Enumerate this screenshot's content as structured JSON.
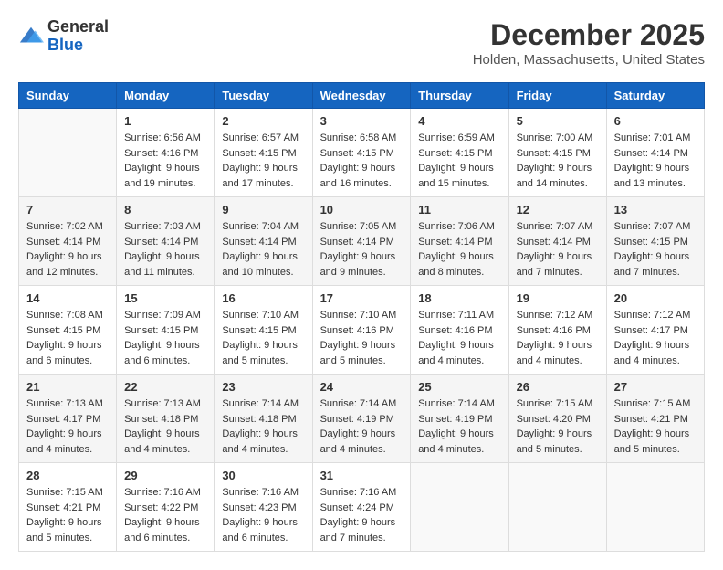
{
  "logo": {
    "general": "General",
    "blue": "Blue"
  },
  "title": {
    "month": "December 2025",
    "location": "Holden, Massachusetts, United States"
  },
  "headers": [
    "Sunday",
    "Monday",
    "Tuesday",
    "Wednesday",
    "Thursday",
    "Friday",
    "Saturday"
  ],
  "weeks": [
    [
      {
        "day": "",
        "sunrise": "",
        "sunset": "",
        "daylight": ""
      },
      {
        "day": "1",
        "sunrise": "Sunrise: 6:56 AM",
        "sunset": "Sunset: 4:16 PM",
        "daylight": "Daylight: 9 hours and 19 minutes."
      },
      {
        "day": "2",
        "sunrise": "Sunrise: 6:57 AM",
        "sunset": "Sunset: 4:15 PM",
        "daylight": "Daylight: 9 hours and 17 minutes."
      },
      {
        "day": "3",
        "sunrise": "Sunrise: 6:58 AM",
        "sunset": "Sunset: 4:15 PM",
        "daylight": "Daylight: 9 hours and 16 minutes."
      },
      {
        "day": "4",
        "sunrise": "Sunrise: 6:59 AM",
        "sunset": "Sunset: 4:15 PM",
        "daylight": "Daylight: 9 hours and 15 minutes."
      },
      {
        "day": "5",
        "sunrise": "Sunrise: 7:00 AM",
        "sunset": "Sunset: 4:15 PM",
        "daylight": "Daylight: 9 hours and 14 minutes."
      },
      {
        "day": "6",
        "sunrise": "Sunrise: 7:01 AM",
        "sunset": "Sunset: 4:14 PM",
        "daylight": "Daylight: 9 hours and 13 minutes."
      }
    ],
    [
      {
        "day": "7",
        "sunrise": "Sunrise: 7:02 AM",
        "sunset": "Sunset: 4:14 PM",
        "daylight": "Daylight: 9 hours and 12 minutes."
      },
      {
        "day": "8",
        "sunrise": "Sunrise: 7:03 AM",
        "sunset": "Sunset: 4:14 PM",
        "daylight": "Daylight: 9 hours and 11 minutes."
      },
      {
        "day": "9",
        "sunrise": "Sunrise: 7:04 AM",
        "sunset": "Sunset: 4:14 PM",
        "daylight": "Daylight: 9 hours and 10 minutes."
      },
      {
        "day": "10",
        "sunrise": "Sunrise: 7:05 AM",
        "sunset": "Sunset: 4:14 PM",
        "daylight": "Daylight: 9 hours and 9 minutes."
      },
      {
        "day": "11",
        "sunrise": "Sunrise: 7:06 AM",
        "sunset": "Sunset: 4:14 PM",
        "daylight": "Daylight: 9 hours and 8 minutes."
      },
      {
        "day": "12",
        "sunrise": "Sunrise: 7:07 AM",
        "sunset": "Sunset: 4:14 PM",
        "daylight": "Daylight: 9 hours and 7 minutes."
      },
      {
        "day": "13",
        "sunrise": "Sunrise: 7:07 AM",
        "sunset": "Sunset: 4:15 PM",
        "daylight": "Daylight: 9 hours and 7 minutes."
      }
    ],
    [
      {
        "day": "14",
        "sunrise": "Sunrise: 7:08 AM",
        "sunset": "Sunset: 4:15 PM",
        "daylight": "Daylight: 9 hours and 6 minutes."
      },
      {
        "day": "15",
        "sunrise": "Sunrise: 7:09 AM",
        "sunset": "Sunset: 4:15 PM",
        "daylight": "Daylight: 9 hours and 6 minutes."
      },
      {
        "day": "16",
        "sunrise": "Sunrise: 7:10 AM",
        "sunset": "Sunset: 4:15 PM",
        "daylight": "Daylight: 9 hours and 5 minutes."
      },
      {
        "day": "17",
        "sunrise": "Sunrise: 7:10 AM",
        "sunset": "Sunset: 4:16 PM",
        "daylight": "Daylight: 9 hours and 5 minutes."
      },
      {
        "day": "18",
        "sunrise": "Sunrise: 7:11 AM",
        "sunset": "Sunset: 4:16 PM",
        "daylight": "Daylight: 9 hours and 4 minutes."
      },
      {
        "day": "19",
        "sunrise": "Sunrise: 7:12 AM",
        "sunset": "Sunset: 4:16 PM",
        "daylight": "Daylight: 9 hours and 4 minutes."
      },
      {
        "day": "20",
        "sunrise": "Sunrise: 7:12 AM",
        "sunset": "Sunset: 4:17 PM",
        "daylight": "Daylight: 9 hours and 4 minutes."
      }
    ],
    [
      {
        "day": "21",
        "sunrise": "Sunrise: 7:13 AM",
        "sunset": "Sunset: 4:17 PM",
        "daylight": "Daylight: 9 hours and 4 minutes."
      },
      {
        "day": "22",
        "sunrise": "Sunrise: 7:13 AM",
        "sunset": "Sunset: 4:18 PM",
        "daylight": "Daylight: 9 hours and 4 minutes."
      },
      {
        "day": "23",
        "sunrise": "Sunrise: 7:14 AM",
        "sunset": "Sunset: 4:18 PM",
        "daylight": "Daylight: 9 hours and 4 minutes."
      },
      {
        "day": "24",
        "sunrise": "Sunrise: 7:14 AM",
        "sunset": "Sunset: 4:19 PM",
        "daylight": "Daylight: 9 hours and 4 minutes."
      },
      {
        "day": "25",
        "sunrise": "Sunrise: 7:14 AM",
        "sunset": "Sunset: 4:19 PM",
        "daylight": "Daylight: 9 hours and 4 minutes."
      },
      {
        "day": "26",
        "sunrise": "Sunrise: 7:15 AM",
        "sunset": "Sunset: 4:20 PM",
        "daylight": "Daylight: 9 hours and 5 minutes."
      },
      {
        "day": "27",
        "sunrise": "Sunrise: 7:15 AM",
        "sunset": "Sunset: 4:21 PM",
        "daylight": "Daylight: 9 hours and 5 minutes."
      }
    ],
    [
      {
        "day": "28",
        "sunrise": "Sunrise: 7:15 AM",
        "sunset": "Sunset: 4:21 PM",
        "daylight": "Daylight: 9 hours and 5 minutes."
      },
      {
        "day": "29",
        "sunrise": "Sunrise: 7:16 AM",
        "sunset": "Sunset: 4:22 PM",
        "daylight": "Daylight: 9 hours and 6 minutes."
      },
      {
        "day": "30",
        "sunrise": "Sunrise: 7:16 AM",
        "sunset": "Sunset: 4:23 PM",
        "daylight": "Daylight: 9 hours and 6 minutes."
      },
      {
        "day": "31",
        "sunrise": "Sunrise: 7:16 AM",
        "sunset": "Sunset: 4:24 PM",
        "daylight": "Daylight: 9 hours and 7 minutes."
      },
      {
        "day": "",
        "sunrise": "",
        "sunset": "",
        "daylight": ""
      },
      {
        "day": "",
        "sunrise": "",
        "sunset": "",
        "daylight": ""
      },
      {
        "day": "",
        "sunrise": "",
        "sunset": "",
        "daylight": ""
      }
    ]
  ]
}
